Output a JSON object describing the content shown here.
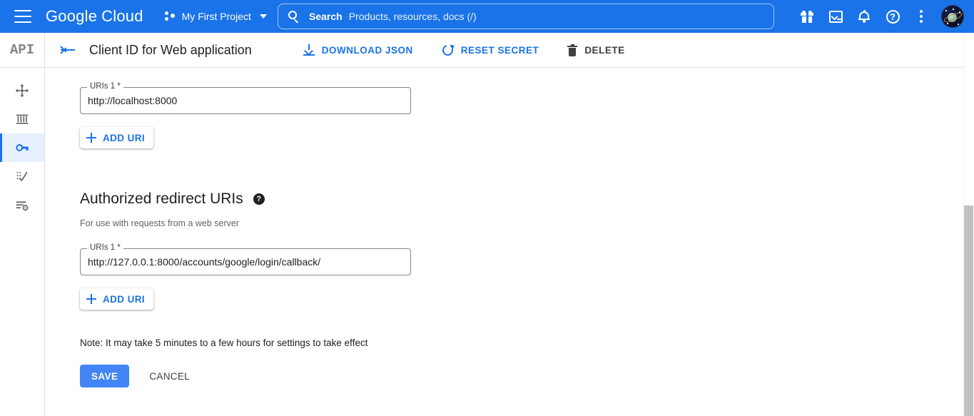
{
  "topbar": {
    "menu_icon": "hamburger-icon",
    "brand_google": "Google",
    "brand_cloud": "Cloud",
    "project_name": "My First Project",
    "project_icon": "project-dots-icon",
    "search": {
      "icon": "search-icon",
      "label": "Search",
      "placeholder": "Products, resources, docs (/)"
    },
    "icons": [
      {
        "name": "gift-icon",
        "title": "Gifts and offers"
      },
      {
        "name": "cloud-shell-icon",
        "title": "Activate Cloud Shell"
      },
      {
        "name": "notifications-bell-icon",
        "title": "Notifications"
      },
      {
        "name": "help-question-icon",
        "title": "Support",
        "glyph": "?"
      },
      {
        "name": "more-kebab-icon",
        "title": "More options"
      },
      {
        "name": "avatar-icon",
        "title": "Account"
      }
    ]
  },
  "sidebar": {
    "logo": "API",
    "items": [
      {
        "name": "sidebar-item-dashboard",
        "icon": "dashboard-compass-icon"
      },
      {
        "name": "sidebar-item-library",
        "icon": "library-columns-icon"
      },
      {
        "name": "sidebar-item-credentials",
        "icon": "key-icon",
        "active": true
      },
      {
        "name": "sidebar-item-oauth-consent",
        "icon": "dotted-check-icon"
      },
      {
        "name": "sidebar-item-domain-verification",
        "icon": "list-gear-icon"
      }
    ]
  },
  "pageheader": {
    "back_icon": "back-arrow-icon",
    "title": "Client ID for Web application",
    "actions": [
      {
        "name": "download-json-button",
        "label": "DOWNLOAD JSON",
        "icon": "download-icon"
      },
      {
        "name": "reset-secret-button",
        "label": "RESET SECRET",
        "icon": "refresh-icon"
      },
      {
        "name": "delete-button",
        "label": "DELETE",
        "icon": "trash-icon"
      }
    ]
  },
  "main": {
    "javascript_origins": {
      "field_label": "URIs 1 *",
      "field_value": "http://localhost:8000",
      "add_uri_label": "ADD URI"
    },
    "redirect_uris": {
      "section_title": "Authorized redirect URIs",
      "help_glyph": "?",
      "section_subtitle": "For use with requests from a web server",
      "field_label": "URIs 1 *",
      "field_value": "http://127.0.0.1:8000/accounts/google/login/callback/",
      "add_uri_label": "ADD URI"
    },
    "note": "Note: It may take 5 minutes to a few hours for settings to take effect",
    "save_label": "SAVE",
    "cancel_label": "CANCEL"
  },
  "colors": {
    "brand_blue": "#1a73e8",
    "save_blue": "#4285f4",
    "active_bg": "#e8f0fe",
    "text_primary": "#202124",
    "text_secondary": "#5f6368"
  }
}
